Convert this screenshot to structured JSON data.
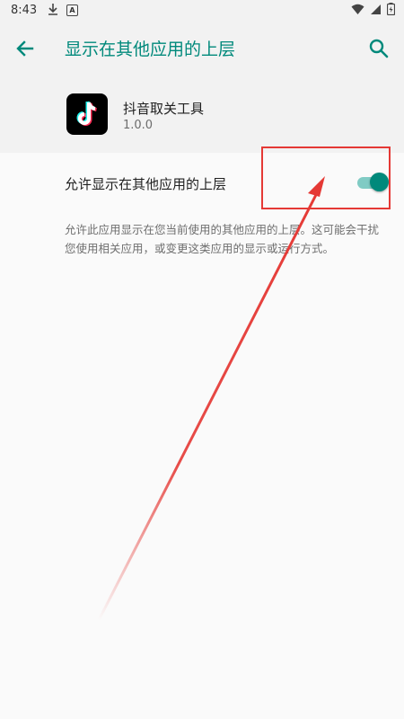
{
  "status_bar": {
    "time": "8:43"
  },
  "toolbar": {
    "title": "显示在其他应用的上层",
    "back_icon": "arrow-back-icon",
    "search_icon": "search-icon"
  },
  "app": {
    "name": "抖音取关工具",
    "version": "1.0.0",
    "icon": "tiktok-logo-icon"
  },
  "setting": {
    "label": "允许显示在其他应用的上层",
    "enabled": true
  },
  "description": "允许此应用显示在您当前使用的其他应用的上层。这可能会干扰您使用相关应用，或变更这类应用的显示或运行方式。",
  "colors": {
    "accent": "#00897b",
    "highlight": "#e53935"
  }
}
